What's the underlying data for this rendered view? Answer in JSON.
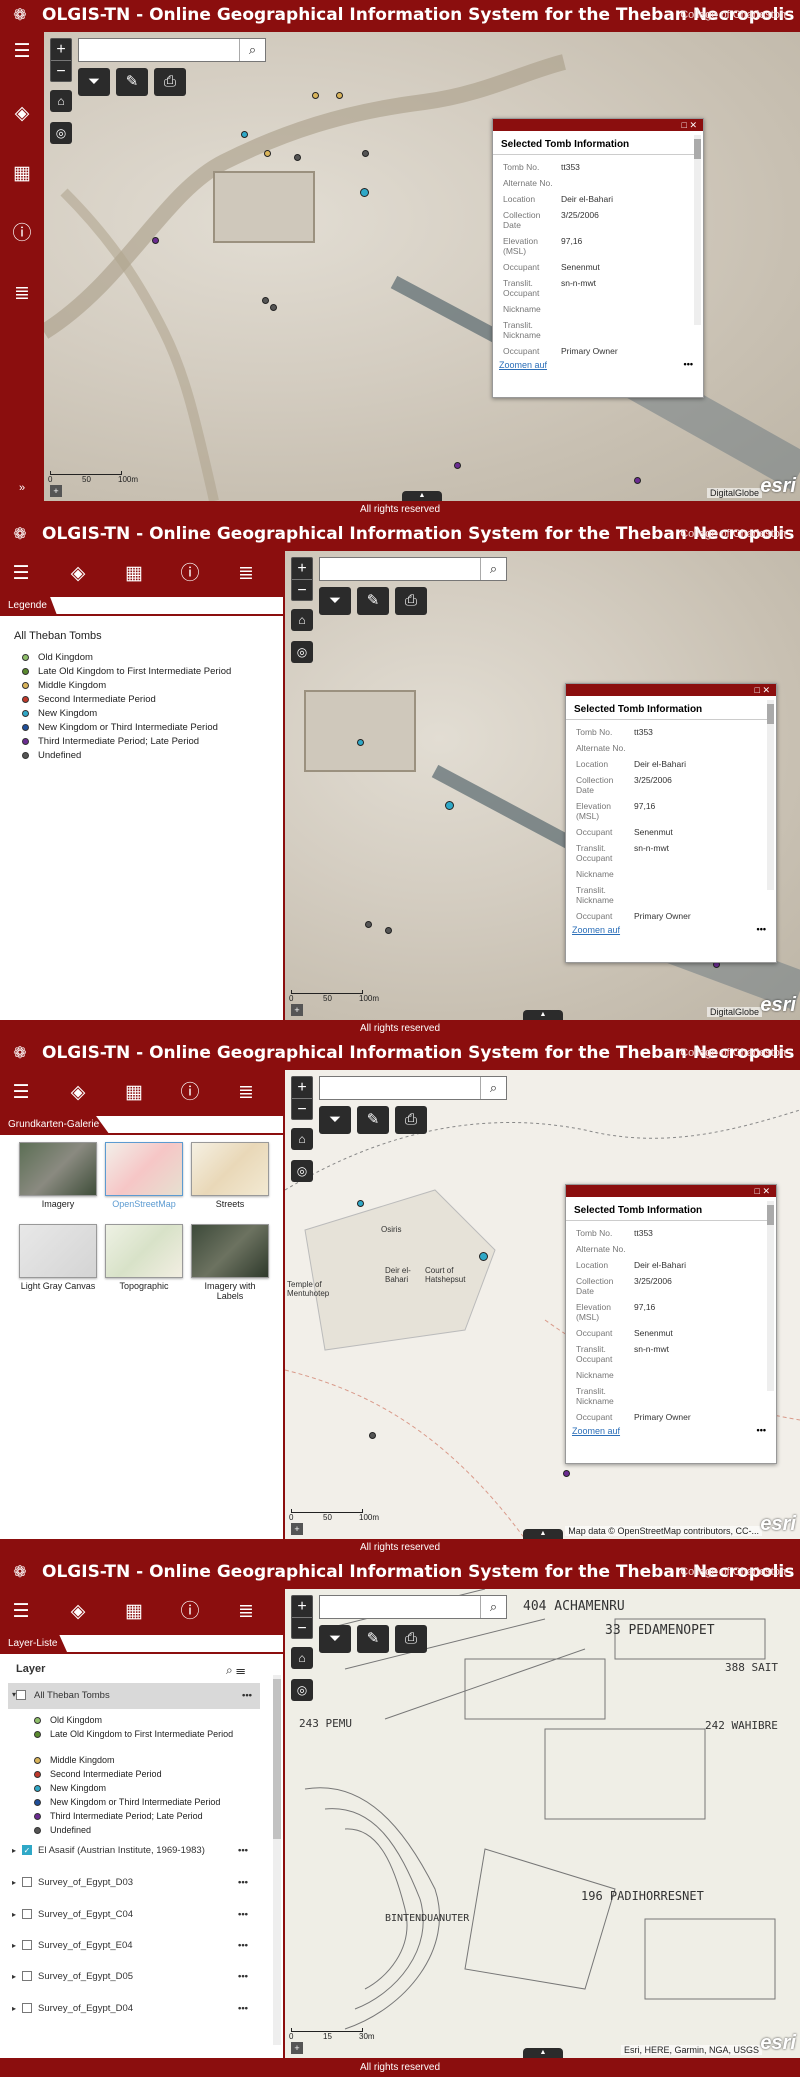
{
  "app": {
    "title": "OLGIS-TN - Online Geographical Information System for the Theban Necropolis",
    "college": "College of Charleston",
    "footer": "All rights reserved"
  },
  "search": {
    "placeholder": ""
  },
  "popup": {
    "title": "Selected Tomb Information",
    "fields": [
      {
        "key": "Tomb No.",
        "value": "tt353"
      },
      {
        "key": "Alternate No.",
        "value": ""
      },
      {
        "key": "Location",
        "value": "Deir el-Bahari"
      },
      {
        "key": "Collection Date",
        "value": "3/25/2006"
      },
      {
        "key": "Elevation (MSL)",
        "value": "97,16"
      },
      {
        "key": "Occupant",
        "value": "Senenmut"
      },
      {
        "key": "Translit. Occupant",
        "value": "sn-n-mwt"
      },
      {
        "key": "Nickname",
        "value": ""
      },
      {
        "key": "Translit. Nickname",
        "value": ""
      },
      {
        "key": "Occupant",
        "value": "Primary Owner"
      }
    ],
    "zoom_link": "Zoomen auf",
    "more": "•••"
  },
  "scale": {
    "labels": [
      "0",
      "50",
      "100m"
    ],
    "labels_topo": [
      "0",
      "15",
      "30m"
    ]
  },
  "attribution": {
    "imagery": "DigitalGlobe",
    "osm": "Map data © OpenStreetMap contributors, CC-...",
    "topo": "Esri, HERE, Garmin, NGA, USGS",
    "esri": "esri"
  },
  "legend": {
    "tab": "Legende",
    "heading": "All Theban Tombs",
    "items": [
      {
        "label": "Old Kingdom",
        "color": "#8fbf6a"
      },
      {
        "label": "Late Old Kingdom to First Intermediate Period",
        "color": "#5a8a2e"
      },
      {
        "label": "Middle Kingdom",
        "color": "#d9b45a"
      },
      {
        "label": "Second Intermediate Period",
        "color": "#c0392b"
      },
      {
        "label": "New Kingdom",
        "color": "#2fa8c7"
      },
      {
        "label": "New Kingdom or Third Intermediate Period",
        "color": "#1f4f9a"
      },
      {
        "label": "Third Intermediate Period; Late Period",
        "color": "#6b2c91"
      },
      {
        "label": "Undefined",
        "color": "#555555"
      }
    ]
  },
  "basemap": {
    "tab": "Grundkarten-Galerie",
    "items": [
      {
        "label": "Imagery"
      },
      {
        "label": "OpenStreetMap"
      },
      {
        "label": "Streets"
      },
      {
        "label": "Light Gray Canvas"
      },
      {
        "label": "Topographic"
      },
      {
        "label": "Imagery with Labels"
      }
    ]
  },
  "layerlist": {
    "tab": "Layer-Liste",
    "heading": "Layer",
    "group": "All Theban Tombs",
    "legend": [
      "Old Kingdom",
      "Late Old Kingdom to First Intermediate Period",
      "Middle Kingdom",
      "Second Intermediate Period",
      "New Kingdom",
      "New Kingdom or Third Intermediate Period",
      "Third Intermediate Period; Late Period",
      "Undefined"
    ],
    "layers": [
      {
        "label": "El Asasif (Austrian Institute, 1969-1983)",
        "checked": true
      },
      {
        "label": "Survey_of_Egypt_D03",
        "checked": false
      },
      {
        "label": "Survey_of_Egypt_C04",
        "checked": false
      },
      {
        "label": "Survey_of_Egypt_E04",
        "checked": false
      },
      {
        "label": "Survey_of_Egypt_D05",
        "checked": false
      },
      {
        "label": "Survey_of_Egypt_D04",
        "checked": false
      }
    ]
  },
  "osm_labels": {
    "a": "Osiris",
    "b": "Deir el-Bahari",
    "c": "Court of Hatshepsut",
    "d": "Temple of Mentuhotep"
  },
  "topo_labels": {
    "a": "404 ACHAMENRU",
    "b": "33 PEDAMENOPET",
    "c": "243 PEMU",
    "d": "242 WAHIBRE",
    "e": "388 SAIT",
    "f": "196 PADIHORRESNET",
    "g": "BINTENDUANUTER"
  }
}
